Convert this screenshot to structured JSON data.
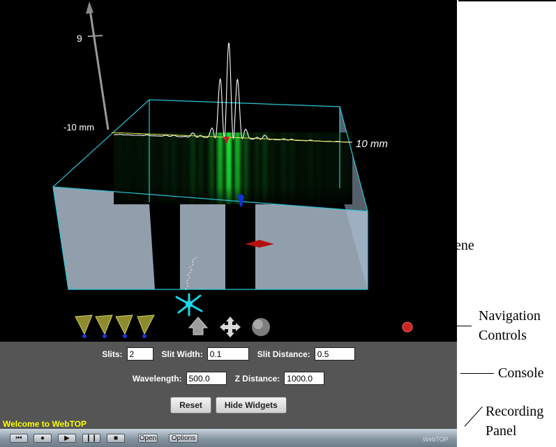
{
  "scene": {
    "axis_top_value": "9",
    "left_extent": "-10 mm",
    "right_extent": "10 mm"
  },
  "console": {
    "slits_label": "Slits:",
    "slits_value": "2",
    "slit_width_label": "Slit Width:",
    "slit_width_value": "0.1",
    "slit_distance_label": "Slit Distance:",
    "slit_distance_value": "0.5",
    "wavelength_label": "Wavelength:",
    "wavelength_value": "500.0",
    "z_distance_label": "Z Distance:",
    "z_distance_value": "1000.0",
    "reset_label": "Reset",
    "hide_widgets_label": "Hide Widgets",
    "welcome": "Welcome to WebTOP"
  },
  "recording": {
    "open_label": "Open",
    "options_label": "Options",
    "logo": "WebTOP"
  },
  "annotations": {
    "scene": "Scene",
    "navigation_1": "Navigation",
    "navigation_2": "Controls",
    "console": "Console",
    "recording_1": "Recording",
    "recording_2": "Panel"
  },
  "icons": [
    "camera-view-icon",
    "pan-arrow-icon",
    "move-cross-icon",
    "sphere-icon",
    "record-dot-icon",
    "rewind-icon",
    "record-icon",
    "play-icon",
    "pause-icon",
    "stop-icon"
  ],
  "colors": {
    "background": "#000000",
    "box_edge": "#29c2d6",
    "fringe": "#22ee44",
    "console_bg": "#555555",
    "welcome": "#ffff00",
    "marker_red": "#cc2222",
    "marker_blue": "#1122cc"
  }
}
